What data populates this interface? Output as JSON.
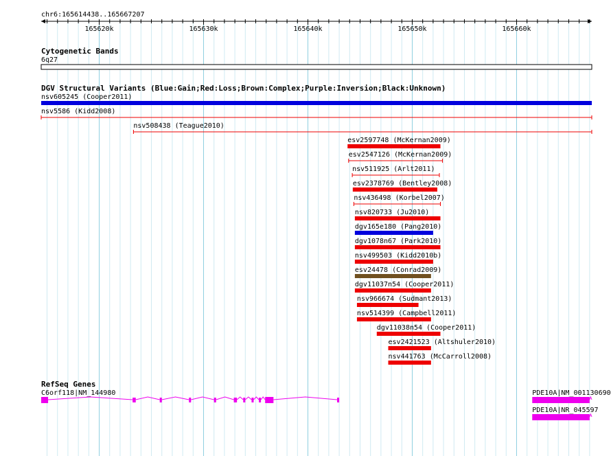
{
  "region": "chr6:165614438..165667207",
  "ruler": {
    "start": 165614438,
    "end": 165667207,
    "ticks": [
      {
        "pos": 165620000,
        "label": "165620k"
      },
      {
        "pos": 165630000,
        "label": "165630k"
      },
      {
        "pos": 165640000,
        "label": "165640k"
      },
      {
        "pos": 165650000,
        "label": "165650k"
      },
      {
        "pos": 165660000,
        "label": "165660k"
      }
    ]
  },
  "cytoband": {
    "title": "Cytogenetic Bands",
    "band": "6q27"
  },
  "dgv": {
    "title": "DGV Structural Variants (Blue:Gain;Red:Loss;Brown:Complex;Purple:Inversion;Black:Unknown)",
    "colors": {
      "gain": "#0000dd",
      "loss": "#ee0000",
      "complex": "#705020"
    },
    "variants": [
      {
        "label": "nsv605245 (Cooper2011)",
        "type": "gain",
        "style": "bar",
        "start": 165614438,
        "end": 165667207
      },
      {
        "label": "nsv5586 (Kidd2008)",
        "type": "loss",
        "style": "line",
        "start": 165614438,
        "end": 165667207
      },
      {
        "label": "nsv508438 (Teague2010)",
        "type": "loss",
        "style": "line",
        "start": 165623280,
        "end": 165667207
      },
      {
        "label": "esv2597748 (McKernan2009)",
        "type": "loss",
        "style": "bar",
        "start": 165643800,
        "end": 165652700
      },
      {
        "label": "esv2547126 (McKernan2009)",
        "type": "loss",
        "style": "line",
        "start": 165643900,
        "end": 165652900
      },
      {
        "label": "nsv511925 (Arlt2011)",
        "type": "loss",
        "style": "line",
        "start": 165644250,
        "end": 165652600
      },
      {
        "label": "esv2378769 (Bentley2008)",
        "type": "loss",
        "style": "bar",
        "start": 165644300,
        "end": 165652400
      },
      {
        "label": "nsv436498 (Korbel2007)",
        "type": "loss",
        "style": "line",
        "start": 165644400,
        "end": 165652700
      },
      {
        "label": "nsv820733 (Ju2010)",
        "type": "loss",
        "style": "bar",
        "start": 165644500,
        "end": 165652700
      },
      {
        "label": "dgv165e180 (Pang2010)",
        "type": "gain",
        "style": "bar",
        "start": 165644500,
        "end": 165652000
      },
      {
        "label": "dgv1078n67 (Park2010)",
        "type": "loss",
        "style": "bar",
        "start": 165644500,
        "end": 165652700
      },
      {
        "label": "nsv499503 (Kidd2010b)",
        "type": "loss",
        "style": "bar",
        "start": 165644500,
        "end": 165652000
      },
      {
        "label": "esv24478 (Conrad2009)",
        "type": "complex",
        "style": "bar",
        "start": 165644500,
        "end": 165651800
      },
      {
        "label": "dgv11037n54 (Cooper2011)",
        "type": "loss",
        "style": "bar",
        "start": 165644500,
        "end": 165651800
      },
      {
        "label": "nsv966674 (Sudmant2013)",
        "type": "loss",
        "style": "bar",
        "start": 165644700,
        "end": 165650600
      },
      {
        "label": "nsv514399 (Campbell2011)",
        "type": "loss",
        "style": "bar",
        "start": 165644700,
        "end": 165651800
      },
      {
        "label": "dgv11038n54 (Cooper2011)",
        "type": "loss",
        "style": "bar",
        "start": 165646600,
        "end": 165652700
      },
      {
        "label": "esv2421523 (Altshuler2010)",
        "type": "loss",
        "style": "bar",
        "start": 165647700,
        "end": 165651800
      },
      {
        "label": "nsv441763 (McCarroll2008)",
        "type": "loss",
        "style": "bar",
        "start": 165647700,
        "end": 165651800
      }
    ]
  },
  "refseq": {
    "title": "RefSeq Genes",
    "color": "#ee00ee",
    "genes": [
      {
        "label": "C6orf118|NM_144980",
        "start": 165614438,
        "end": 165643000,
        "exons": [
          [
            165614438,
            165615100
          ],
          [
            165623200,
            165623500
          ],
          [
            165625800,
            165626000
          ],
          [
            165628600,
            165628800
          ],
          [
            165631000,
            165631200
          ],
          [
            165632900,
            165633200
          ],
          [
            165633800,
            165634000
          ],
          [
            165634600,
            165634800
          ],
          [
            165635300,
            165635500
          ],
          [
            165635900,
            165636700
          ],
          [
            165642800,
            165643000
          ]
        ]
      },
      {
        "label": "PDE10A|NM_001130690",
        "start": 165661500,
        "end": 165667207,
        "exons": [
          [
            165661500,
            165667000
          ]
        ]
      },
      {
        "label": "PDE10A|NR_045597",
        "start": 165661500,
        "end": 165667207,
        "exons": [
          [
            165661500,
            165667000
          ]
        ]
      }
    ]
  }
}
